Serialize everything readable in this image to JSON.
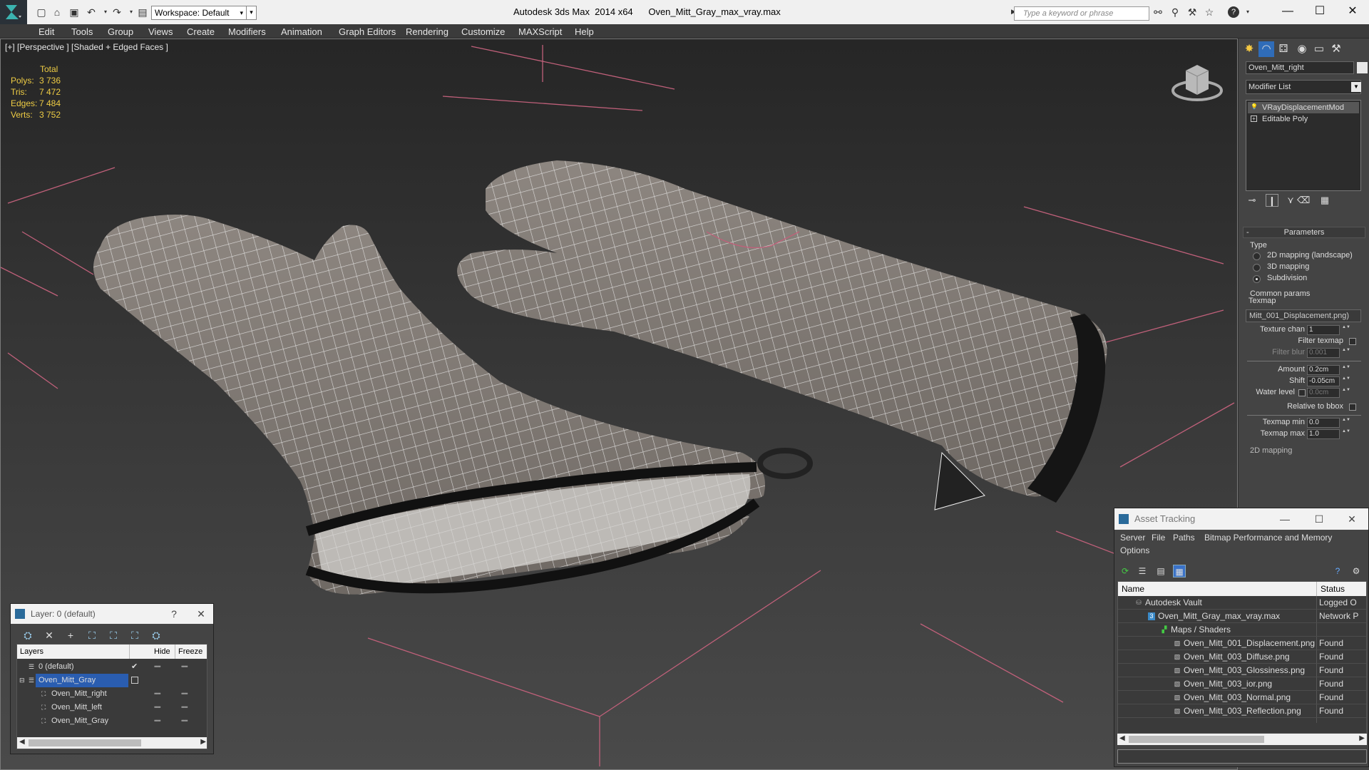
{
  "titlebar": {
    "workspace": "Workspace: Default",
    "title": "Autodesk 3ds Max  2014 x64      Oven_Mitt_Gray_max_vray.max",
    "search_placeholder": "Type a keyword or phrase"
  },
  "menu": [
    "Edit",
    "Tools",
    "Group",
    "Views",
    "Create",
    "Modifiers",
    "Animation",
    "Graph Editors",
    "Rendering",
    "Customize",
    "MAXScript",
    "Help"
  ],
  "viewport": {
    "label": "[+] [Perspective ] [Shaded + Edged Faces ]",
    "stats": {
      "header": "Total",
      "rows": [
        {
          "label": "Polys:",
          "value": "3 736"
        },
        {
          "label": "Tris:",
          "value": "7 472"
        },
        {
          "label": "Edges:",
          "value": "7 484"
        },
        {
          "label": "Verts:",
          "value": "3 752"
        }
      ]
    }
  },
  "command_panel": {
    "object_name": "Oven_Mitt_right",
    "modifier_list": "Modifier List",
    "stack": [
      "VRayDisplacementMod",
      "Editable Poly"
    ],
    "params_title": "Parameters",
    "type_label": "Type",
    "type_options": [
      "2D mapping (landscape)",
      "3D mapping",
      "Subdivision"
    ],
    "type_selected": 2,
    "common_label": "Common params",
    "texmap_label": "Texmap",
    "texmap_value": "Mitt_001_Displacement.png)",
    "texture_chan_label": "Texture chan",
    "texture_chan": "1",
    "filter_texmap_label": "Filter texmap",
    "filter_blur_label": "Filter blur",
    "filter_blur": "0.001",
    "amount_label": "Amount",
    "amount": "0.2cm",
    "shift_label": "Shift",
    "shift": "-0.05cm",
    "water_label": "Water level",
    "water": "0.0cm",
    "relative_label": "Relative to bbox",
    "texmap_min_label": "Texmap min",
    "texmap_min": "0.0",
    "texmap_max_label": "Texmap max",
    "texmap_max": "1.0",
    "mapping_2d_label": "2D mapping"
  },
  "asset_tracking": {
    "title": "Asset Tracking",
    "menu": [
      "Server",
      "File",
      "Paths",
      "Bitmap Performance and Memory",
      "Options"
    ],
    "col_name": "Name",
    "col_status": "Status",
    "rows": [
      {
        "name": "Autodesk Vault",
        "status": "Logged O"
      },
      {
        "name": "Oven_Mitt_Gray_max_vray.max",
        "status": "Network P"
      },
      {
        "name": "Maps / Shaders",
        "status": ""
      },
      {
        "name": "Oven_Mitt_001_Displacement.png",
        "status": "Found"
      },
      {
        "name": "Oven_Mitt_003_Diffuse.png",
        "status": "Found"
      },
      {
        "name": "Oven_Mitt_003_Glossiness.png",
        "status": "Found"
      },
      {
        "name": "Oven_Mitt_003_ior.png",
        "status": "Found"
      },
      {
        "name": "Oven_Mitt_003_Normal.png",
        "status": "Found"
      },
      {
        "name": "Oven_Mitt_003_Reflection.png",
        "status": "Found"
      }
    ]
  },
  "layer_window": {
    "title": "Layer: 0 (default)",
    "help": "?",
    "col_layers": "Layers",
    "col_hide": "Hide",
    "col_freeze": "Freeze",
    "rows": [
      {
        "name": "0 (default)"
      },
      {
        "name": "Oven_Mitt_Gray"
      },
      {
        "name": "Oven_Mitt_right"
      },
      {
        "name": "Oven_Mitt_left"
      },
      {
        "name": "Oven_Mitt_Gray"
      }
    ]
  }
}
